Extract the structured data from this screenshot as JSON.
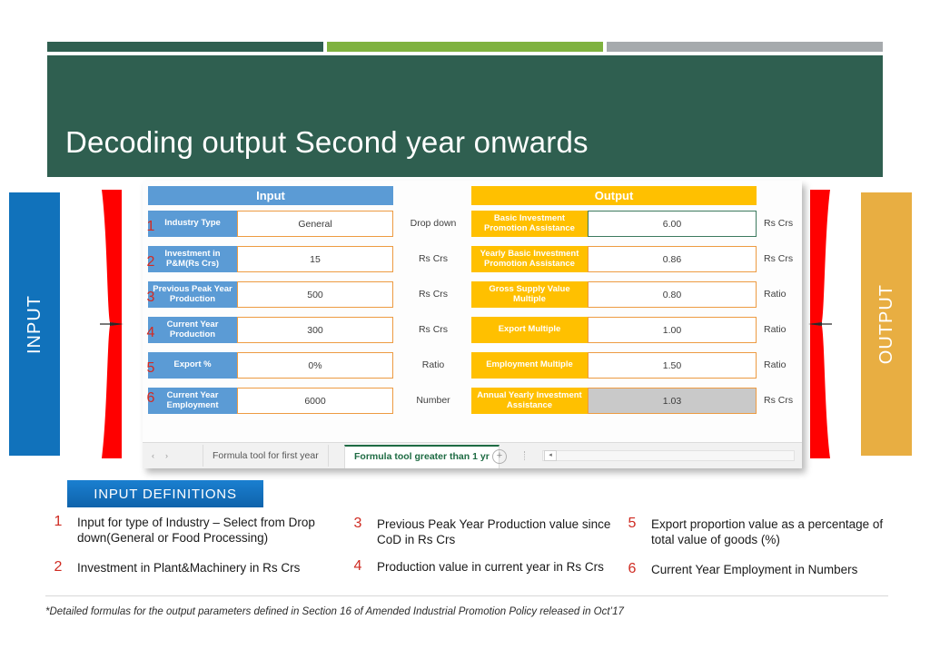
{
  "slide": {
    "title": "Decoding output Second year onwards",
    "accent_dark_green": "#2f5f50",
    "accent_light_green": "#7fb23f",
    "accent_gray": "#a6aaad"
  },
  "side_banners": {
    "left_label": "INPUT",
    "left_color": "#1172bb",
    "right_label": "OUTPUT",
    "right_color": "#e8ae42",
    "brace_color": "#ff0000"
  },
  "spreadsheet": {
    "input_header": "Input",
    "output_header": "Output",
    "input_rows": [
      {
        "index": "1",
        "label": "Industry Type",
        "value": "General",
        "unit": "Drop down"
      },
      {
        "index": "2",
        "label": "Investment in P&M(Rs Crs)",
        "value": "15",
        "unit": "Rs Crs"
      },
      {
        "index": "3",
        "label": "Previous Peak Year Production",
        "value": "500",
        "unit": "Rs Crs"
      },
      {
        "index": "4",
        "label": "Current Year Production",
        "value": "300",
        "unit": "Rs Crs"
      },
      {
        "index": "5",
        "label": "Export %",
        "value": "0%",
        "unit": "Ratio"
      },
      {
        "index": "6",
        "label": "Current Year Employment",
        "value": "6000",
        "unit": "Number"
      }
    ],
    "output_rows": [
      {
        "label": "Basic Investment Promotion Assistance",
        "value": "6.00",
        "unit": "Rs Crs",
        "selected": true
      },
      {
        "label": "Yearly Basic Investment Promotion Assistance",
        "value": "0.86",
        "unit": "Rs Crs"
      },
      {
        "label": "Gross Supply Value Multiple",
        "value": "0.80",
        "unit": "Ratio"
      },
      {
        "label": "Export Multiple",
        "value": "1.00",
        "unit": "Ratio"
      },
      {
        "label": "Employment  Multiple",
        "value": "1.50",
        "unit": "Ratio"
      },
      {
        "label": "Annual Yearly Investment Assistance",
        "value": "1.03",
        "unit": "Rs Crs",
        "gray": true
      }
    ],
    "tabs": [
      {
        "label": "Formula tool for first year",
        "active": false
      },
      {
        "label": "Formula tool greater than 1 yr",
        "active": true
      }
    ],
    "tab_prev_icon": "‹",
    "tab_next_icon": "›",
    "tab_add_icon": "+",
    "scroll_left_icon": "◂"
  },
  "definitions": {
    "heading": "INPUT DEFINITIONS",
    "items": [
      {
        "num": "1",
        "text": "Input for type of Industry – Select from Drop down(General or Food Processing)"
      },
      {
        "num": "2",
        "text": "Investment in Plant&Machinery in Rs Crs"
      },
      {
        "num": "3",
        "text": "Previous Peak Year Production value since CoD in Rs Crs"
      },
      {
        "num": "4",
        "text": "Production value in current year in Rs Crs"
      },
      {
        "num": "5",
        "text": "Export proportion value as a percentage of total value of goods (%)"
      },
      {
        "num": "6",
        "text": "Current Year Employment in Numbers"
      }
    ]
  },
  "footnote": "*Detailed formulas for the output parameters defined in Section 16 of Amended Industrial Promotion Policy released in Oct’17"
}
